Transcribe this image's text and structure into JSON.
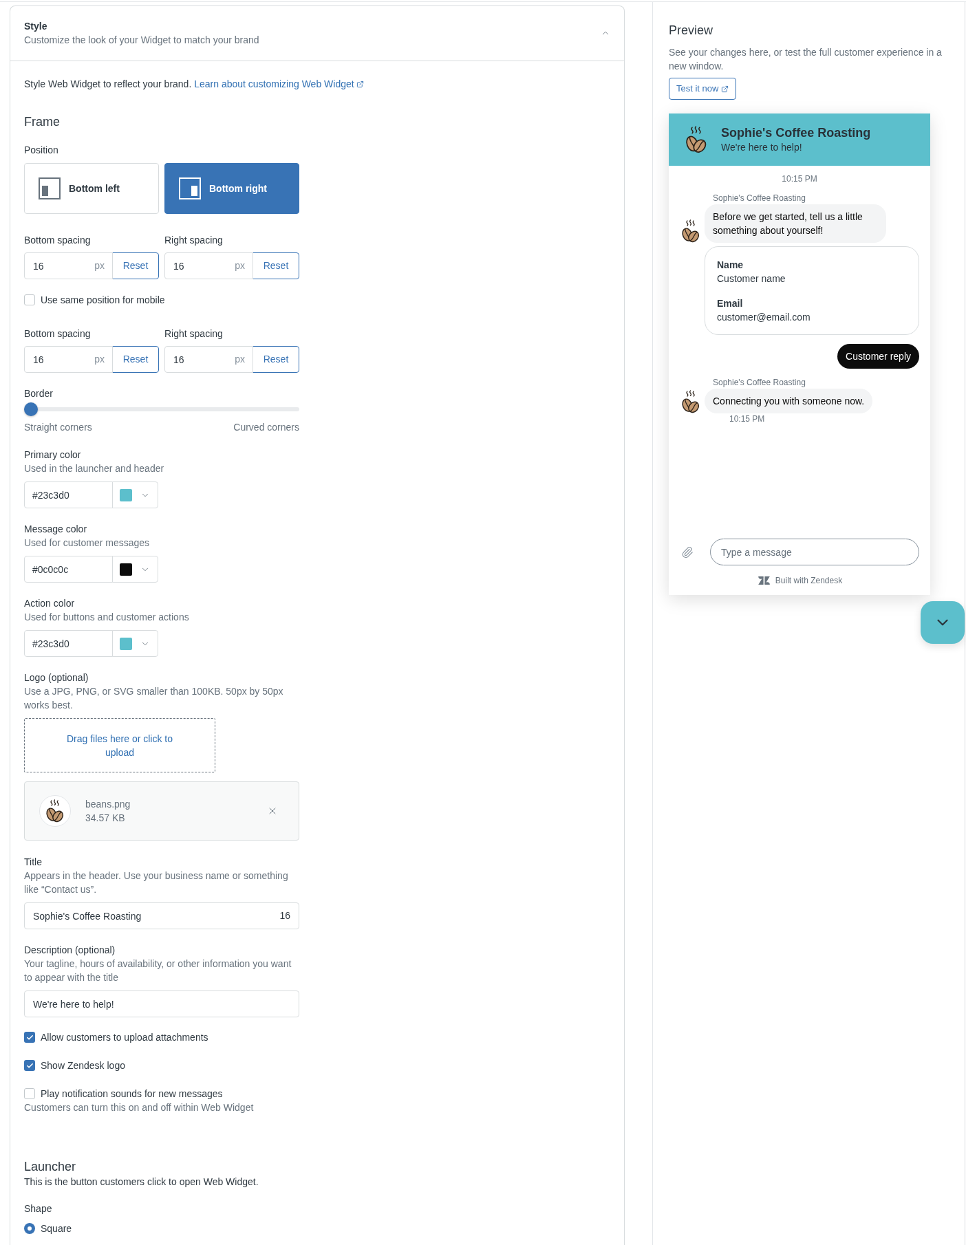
{
  "section": {
    "title": "Style",
    "subtitle": "Customize the look of your Widget to match your brand",
    "expanded": true
  },
  "intro": {
    "text": "Style Web Widget to reflect your brand.",
    "link": "Learn about customizing Web Widget"
  },
  "frame": {
    "heading": "Frame",
    "position_label": "Position",
    "positions": [
      {
        "label": "Bottom left",
        "kind": "left",
        "selected": false
      },
      {
        "label": "Bottom right",
        "kind": "right",
        "selected": true
      }
    ],
    "spacing": [
      {
        "label": "Bottom spacing",
        "value": "16",
        "unit": "px",
        "button": "Reset"
      },
      {
        "label": "Right spacing",
        "value": "16",
        "unit": "px",
        "button": "Reset"
      }
    ],
    "mobile_same_position": {
      "label": "Use same position for mobile",
      "checked": false
    },
    "mobile_spacing": [
      {
        "label": "Bottom spacing",
        "value": "16",
        "unit": "px",
        "button": "Reset"
      },
      {
        "label": "Right spacing",
        "value": "16",
        "unit": "px",
        "button": "Reset"
      }
    ],
    "border": {
      "label": "Border",
      "level": 0,
      "min_label": "Straight corners",
      "max_label": "Curved corners"
    }
  },
  "colors": [
    {
      "label": "Primary color",
      "hint": "Used in the launcher and header",
      "value": "#23c3d0",
      "color": "#5cbfcc"
    },
    {
      "label": "Message color",
      "hint": "Used for customer messages",
      "value": "#0c0c0c",
      "color": "#0c0c0c"
    },
    {
      "label": "Action color",
      "hint": "Used for buttons and customer actions",
      "value": "#23c3d0",
      "color": "#5cbfcc"
    }
  ],
  "logo": {
    "label": "Logo (optional)",
    "hint": "Use a JPG, PNG, or SVG smaller than 100KB. 50px by 50px works best.",
    "dropzone": "Drag files here or click to upload",
    "file": {
      "name": "beans.png",
      "size": "34.57 KB"
    }
  },
  "title": {
    "label": "Title",
    "hint": "Appears in the header. Use your business name or something like “Contact us”.",
    "value": "Sophie's Coffee Roasting",
    "count": "16"
  },
  "description": {
    "label": "Description (optional)",
    "hint": "Your tagline, hours of availability, or other information you want to appear with the title",
    "value": "We're here to help!"
  },
  "options": [
    {
      "label": "Allow customers to upload attachments",
      "checked": true
    },
    {
      "label": "Show Zendesk logo",
      "checked": true
    },
    {
      "label": "Play notification sounds for new messages",
      "checked": false,
      "hint": "Customers can turn this on and off within Web Widget"
    }
  ],
  "launcher": {
    "heading": "Launcher",
    "description": "This is the button customers click to open Web Widget.",
    "shape_label": "Shape",
    "shapes": [
      {
        "label": "Square",
        "selected": true
      }
    ]
  },
  "preview": {
    "heading": "Preview",
    "description": "See your changes here, or test the full customer experience in a new window.",
    "button": "Test it now",
    "widget": {
      "title": "Sophie's Coffee Roasting",
      "subtitle": "We're here to help!",
      "messages": [
        {
          "kind": "timestamp",
          "text": "10:15 PM"
        },
        {
          "kind": "agent",
          "sender": "Sophie's Coffee Roasting",
          "text": "Before we get started, tell us a little something about yourself!"
        },
        {
          "kind": "form",
          "fields": [
            {
              "label": "Name",
              "value": "Customer name"
            },
            {
              "label": "Email",
              "value": "customer@email.com"
            }
          ]
        },
        {
          "kind": "customer",
          "text": "Customer reply"
        },
        {
          "kind": "agent",
          "sender": "Sophie's Coffee Roasting",
          "text": "Connecting you with someone now.",
          "time": "10:15 PM"
        }
      ],
      "composer": {
        "placeholder": "Type a message"
      },
      "footer": "Built with Zendesk"
    }
  }
}
